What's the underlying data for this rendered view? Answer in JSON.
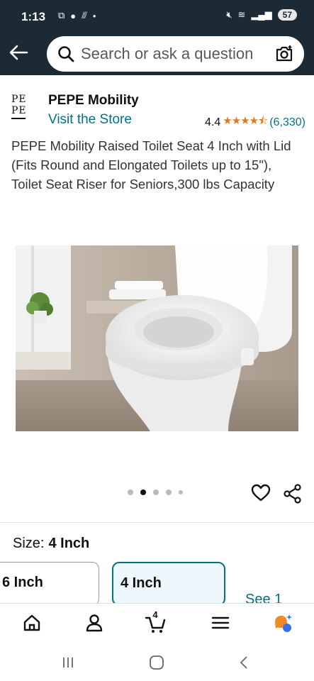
{
  "status": {
    "time": "1:13",
    "battery": "57"
  },
  "search": {
    "placeholder": "Search or ask a question"
  },
  "brand": {
    "logo_line1": "PE",
    "logo_line2": "PE",
    "name": "PEPE Mobility",
    "visit_store": "Visit the Store"
  },
  "rating": {
    "value": "4.4",
    "stars": "★★★★⯪",
    "count": "(6,330)"
  },
  "product": {
    "title": "PEPE Mobility Raised Toilet Seat 4 Inch with Lid (Fits Round and Elongated Toilets up to 15\"), Toilet Seat Riser for Seniors,300 lbs Capacity"
  },
  "carousel": {
    "total_dots": 5,
    "active_index": 1
  },
  "size": {
    "label": "Size:",
    "selected": "4 Inch",
    "options": [
      {
        "label": "6 Inch"
      },
      {
        "label": "4 Inch"
      }
    ],
    "see_more": "See 1"
  },
  "nav": {
    "cart_count": "4"
  },
  "icons": {
    "back": "back-arrow-icon",
    "search": "search-icon",
    "camera": "camera-search-icon",
    "heart": "heart-icon",
    "share": "share-icon",
    "home": "home-icon",
    "account": "account-icon",
    "cart": "cart-icon",
    "menu": "menu-icon",
    "rufus": "rufus-ai-icon"
  },
  "colors": {
    "header_bg": "#1b2a35",
    "link": "#007185",
    "star": "#de7921",
    "selected_border": "#007185"
  }
}
